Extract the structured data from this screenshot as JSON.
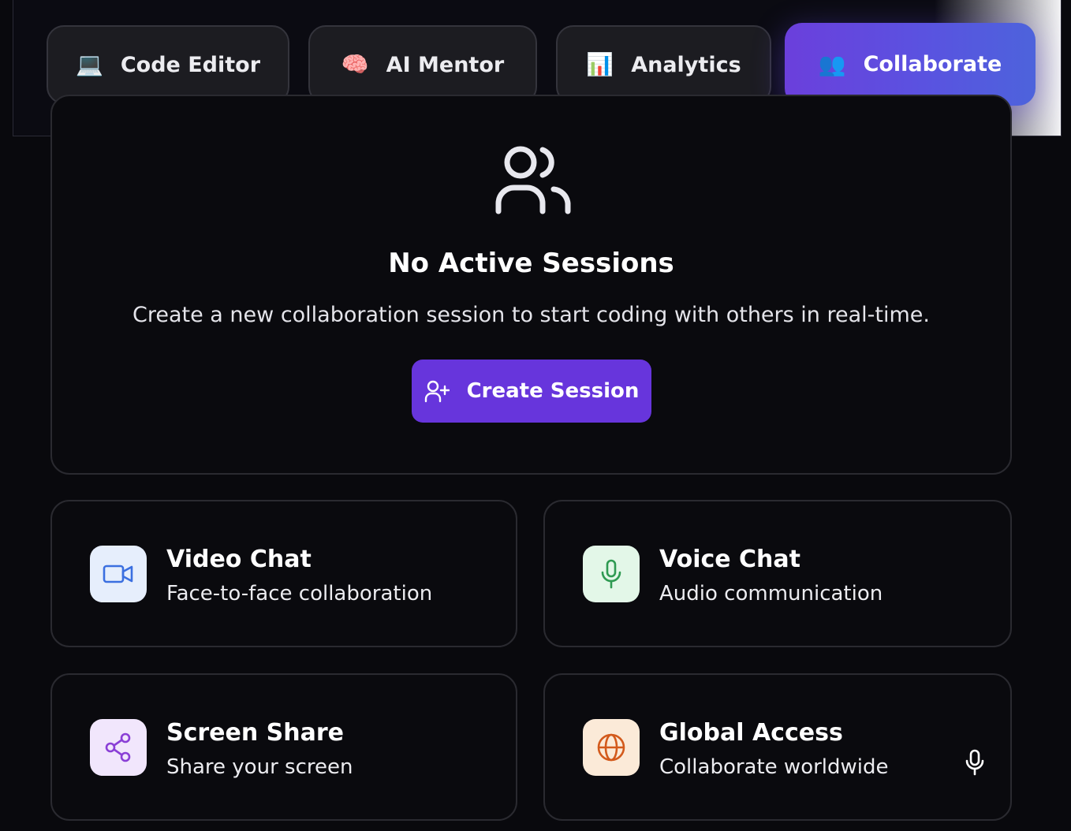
{
  "tabs": [
    {
      "label": "Code Editor",
      "icon": "laptop-icon",
      "emoji": "💻",
      "active": false
    },
    {
      "label": "AI Mentor",
      "icon": "brain-icon",
      "emoji": "🧠",
      "active": false
    },
    {
      "label": "Analytics",
      "icon": "bar-chart-icon",
      "emoji": "📊",
      "active": false
    },
    {
      "label": "Collaborate",
      "icon": "people-icon",
      "emoji": "👥",
      "active": true
    }
  ],
  "empty_state": {
    "icon": "users-icon",
    "title": "No Active Sessions",
    "description": "Create a new collaboration session to start coding with others in real-time.",
    "button_label": "Create Session",
    "button_icon": "user-plus-icon"
  },
  "features": [
    {
      "title": "Video Chat",
      "subtitle": "Face-to-face collaboration",
      "icon": "video-icon",
      "icon_color": "#3b6fe0",
      "bg_color": "#e6eefc"
    },
    {
      "title": "Voice Chat",
      "subtitle": "Audio communication",
      "icon": "mic-icon",
      "icon_color": "#2f9a52",
      "bg_color": "#e3f7e8"
    },
    {
      "title": "Screen Share",
      "subtitle": "Share your screen",
      "icon": "share-icon",
      "icon_color": "#8a3fd6",
      "bg_color": "#f1e6fc"
    },
    {
      "title": "Global Access",
      "subtitle": "Collaborate worldwide",
      "icon": "globe-icon",
      "icon_color": "#d35a1c",
      "bg_color": "#fbead8"
    }
  ],
  "colors": {
    "accent": "#6735dc",
    "background": "#09090d"
  }
}
